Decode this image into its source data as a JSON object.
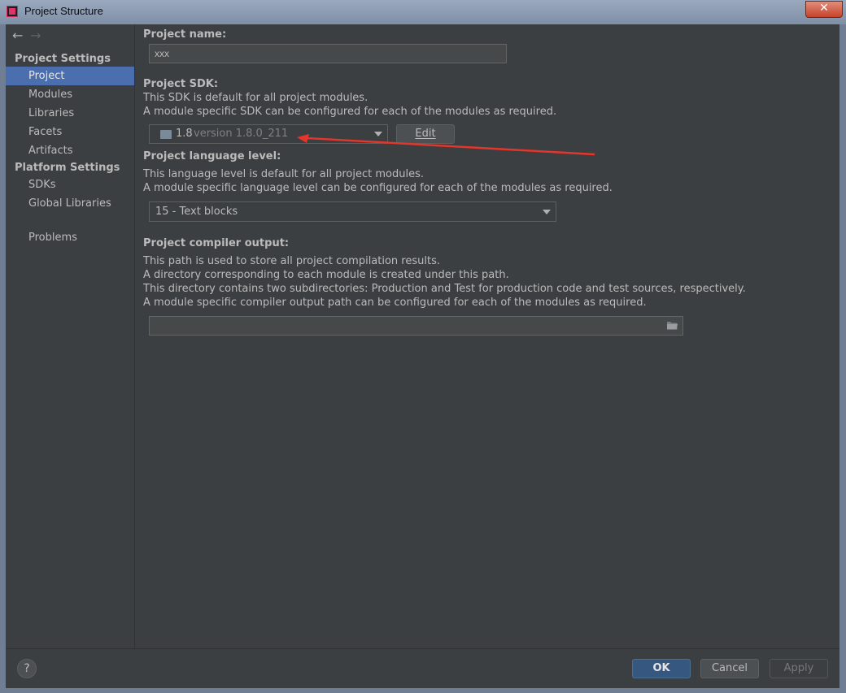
{
  "window": {
    "title": "Project Structure",
    "close_glyph": "✕"
  },
  "nav": {
    "back_glyph": "←",
    "forward_glyph": "→"
  },
  "sidebar": {
    "project_settings_header": "Project Settings",
    "platform_settings_header": "Platform Settings",
    "items": [
      {
        "label": "Project"
      },
      {
        "label": "Modules"
      },
      {
        "label": "Libraries"
      },
      {
        "label": "Facets"
      },
      {
        "label": "Artifacts"
      },
      {
        "label": "SDKs"
      },
      {
        "label": "Global Libraries"
      },
      {
        "label": "Problems"
      }
    ]
  },
  "project": {
    "name_label": "Project name:",
    "name_value": "xxx",
    "sdk_label": "Project SDK:",
    "sdk_desc_1": "This SDK is default for all project modules.",
    "sdk_desc_2": "A module specific SDK can be configured for each of the modules as required.",
    "sdk_value": "1.8",
    "sdk_version": "version 1.8.0_211",
    "edit_label": "Edit",
    "lang_label": "Project language level:",
    "lang_desc_1": "This language level is default for all project modules.",
    "lang_desc_2": "A module specific language level can be configured for each of the modules as required.",
    "lang_value": "15 - Text blocks",
    "output_label": "Project compiler output:",
    "output_desc_1": "This path is used to store all project compilation results.",
    "output_desc_2": "A directory corresponding to each module is created under this path.",
    "output_desc_3": "This directory contains two subdirectories: Production and Test for production code and test sources, respectively.",
    "output_desc_4": "A module specific compiler output path can be configured for each of the modules as required.",
    "output_value": ""
  },
  "footer": {
    "help_glyph": "?",
    "ok_label": "OK",
    "cancel_label": "Cancel",
    "apply_label": "Apply"
  },
  "colors": {
    "background": "#3c3f41",
    "selection": "#4b6eaf",
    "primary_button": "#365880",
    "annotation_arrow": "#e8352b"
  }
}
